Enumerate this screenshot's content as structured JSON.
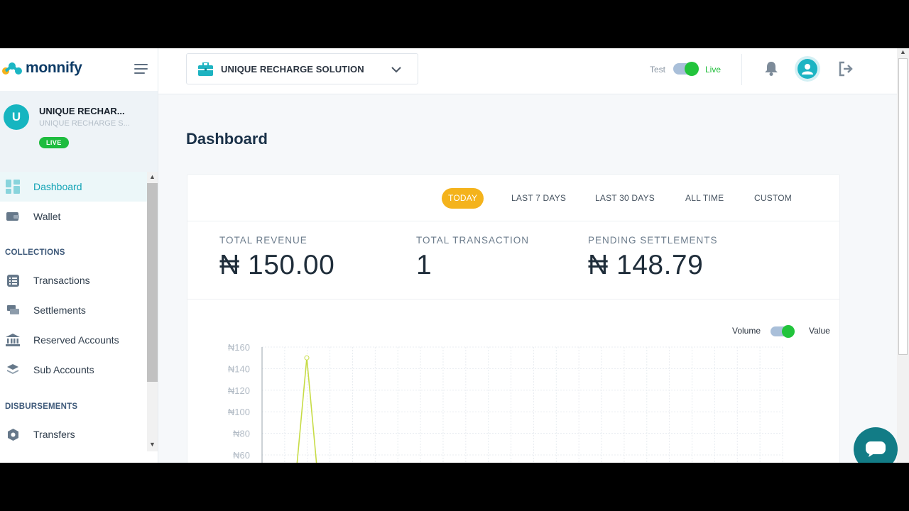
{
  "app": {
    "brand": "monnify"
  },
  "account": {
    "initial": "U",
    "name": "UNIQUE RECHAR...",
    "subtitle": "UNIQUE RECHARGE S...",
    "badge": "LIVE"
  },
  "sidebar": {
    "items": [
      {
        "label": "Dashboard",
        "icon": "dashboard-icon",
        "active": true
      },
      {
        "label": "Wallet",
        "icon": "wallet-icon"
      },
      {
        "label": "Transactions",
        "icon": "transactions-icon"
      },
      {
        "label": "Settlements",
        "icon": "settlements-icon"
      },
      {
        "label": "Reserved Accounts",
        "icon": "bank-icon"
      },
      {
        "label": "Sub Accounts",
        "icon": "layers-icon"
      },
      {
        "label": "Transfers",
        "icon": "transfers-icon"
      }
    ],
    "sections": {
      "collections": "COLLECTIONS",
      "disbursements": "DISBURSEMENTS"
    }
  },
  "topbar": {
    "business": "UNIQUE RECHARGE SOLUTION",
    "test_label": "Test",
    "live_label": "Live",
    "mode": "live"
  },
  "page": {
    "title": "Dashboard"
  },
  "filters": [
    "TODAY",
    "LAST 7 DAYS",
    "LAST 30 DAYS",
    "ALL TIME",
    "CUSTOM"
  ],
  "active_filter": "TODAY",
  "stats": [
    {
      "label": "TOTAL REVENUE",
      "value": "₦ 150.00"
    },
    {
      "label": "TOTAL TRANSACTION",
      "value": "1"
    },
    {
      "label": "PENDING SETTLEMENTS",
      "value": "₦ 148.79"
    }
  ],
  "chart_toggle": {
    "left": "Volume",
    "right": "Value",
    "selected": "Value"
  },
  "colors": {
    "accent": "#12a3b5",
    "filter_active": "#f4b31c",
    "live": "#22c43c",
    "line": "#c7dc46"
  },
  "chart_data": {
    "type": "line",
    "ylim": [
      60,
      160
    ],
    "yticks": [
      "₦160",
      "₦140",
      "₦120",
      "₦100",
      "₦80",
      "₦60"
    ],
    "ytick_values": [
      160,
      140,
      120,
      100,
      80,
      60
    ],
    "grid": true,
    "series": [
      {
        "values": [
          0,
          150,
          0
        ]
      }
    ]
  }
}
